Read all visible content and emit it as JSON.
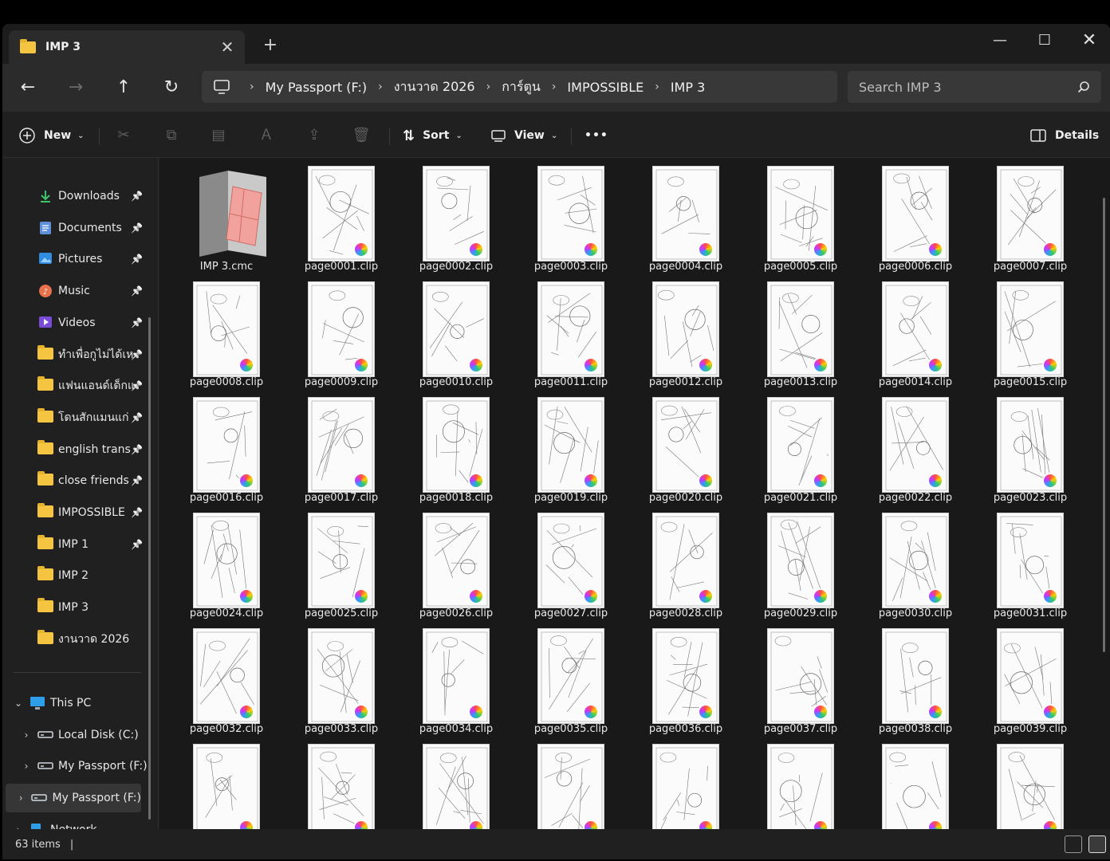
{
  "tab": {
    "title": "IMP 3",
    "close_glyph": "✕",
    "new_tab_glyph": "+"
  },
  "window_controls": {
    "minimize": "—",
    "maximize": "☐",
    "close": "✕"
  },
  "nav": {
    "back": "←",
    "forward": "→",
    "up": "↑",
    "refresh": "↻"
  },
  "breadcrumb": [
    "My Passport (F:)",
    "งานวาด 2026",
    "การ์ตูน",
    "IMPOSSIBLE",
    "IMP 3"
  ],
  "search": {
    "placeholder": "Search IMP 3"
  },
  "toolbar": {
    "new_label": "New",
    "sort_label": "Sort",
    "view_label": "View",
    "more_label": "•••",
    "details_label": "Details"
  },
  "sidebar": {
    "quick_access": [
      {
        "label": "Downloads",
        "icon": "download-icon",
        "pinned": true
      },
      {
        "label": "Documents",
        "icon": "documents-icon",
        "pinned": true
      },
      {
        "label": "Pictures",
        "icon": "pictures-icon",
        "pinned": true
      },
      {
        "label": "Music",
        "icon": "music-icon",
        "pinned": true
      },
      {
        "label": "Videos",
        "icon": "videos-icon",
        "pinned": true
      },
      {
        "label": "ทำเพื่อกูไม่ได้เหรอ",
        "icon": "folder-icon",
        "pinned": true
      },
      {
        "label": "แฟนแอนด์เด็กแก",
        "icon": "folder-icon",
        "pinned": true
      },
      {
        "label": "โดนสักแมนแก่",
        "icon": "folder-icon",
        "pinned": true
      },
      {
        "label": "english trans",
        "icon": "folder-icon",
        "pinned": true
      },
      {
        "label": "close friends",
        "icon": "folder-icon",
        "pinned": true
      },
      {
        "label": "IMPOSSIBLE",
        "icon": "folder-icon",
        "pinned": true
      },
      {
        "label": "IMP 1",
        "icon": "folder-icon",
        "pinned": true
      },
      {
        "label": "IMP 2",
        "icon": "folder-icon",
        "pinned": false
      },
      {
        "label": "IMP 3",
        "icon": "folder-icon",
        "pinned": false
      },
      {
        "label": "งานวาด 2026",
        "icon": "folder-icon",
        "pinned": false
      }
    ],
    "tree": [
      {
        "label": "This PC",
        "icon": "monitor-icon",
        "expander": "⌄",
        "indent": 0
      },
      {
        "label": "Local Disk (C:)",
        "icon": "drive-icon",
        "expander": "›",
        "indent": 1
      },
      {
        "label": "My Passport (F:)",
        "icon": "drive-icon",
        "expander": "›",
        "indent": 1
      },
      {
        "label": "My Passport (F:)",
        "icon": "drive-icon",
        "expander": "›",
        "indent": 0,
        "selected": true
      },
      {
        "label": "Network",
        "icon": "network-icon",
        "expander": "›",
        "indent": 0
      }
    ]
  },
  "files": [
    "IMP 3.cmc",
    "page0001.clip",
    "page0002.clip",
    "page0003.clip",
    "page0004.clip",
    "page0005.clip",
    "page0006.clip",
    "page0007.clip",
    "page0008.clip",
    "page0009.clip",
    "page0010.clip",
    "page0011.clip",
    "page0012.clip",
    "page0013.clip",
    "page0014.clip",
    "page0015.clip",
    "page0016.clip",
    "page0017.clip",
    "page0018.clip",
    "page0019.clip",
    "page0020.clip",
    "page0021.clip",
    "page0022.clip",
    "page0023.clip",
    "page0024.clip",
    "page0025.clip",
    "page0026.clip",
    "page0027.clip",
    "page0028.clip",
    "page0029.clip",
    "page0030.clip",
    "page0031.clip",
    "page0032.clip",
    "page0033.clip",
    "page0034.clip",
    "page0035.clip",
    "page0036.clip",
    "page0037.clip",
    "page0038.clip",
    "page0039.clip",
    "",
    "",
    "",
    "",
    "",
    "",
    "",
    ""
  ],
  "status": {
    "item_count": "63 items",
    "separator": "|"
  },
  "colors": {
    "window_bg": "#202020",
    "content_bg": "#191919",
    "address_bg": "#383838",
    "folder": "#f5c542",
    "accent": "#4cc2ff"
  }
}
